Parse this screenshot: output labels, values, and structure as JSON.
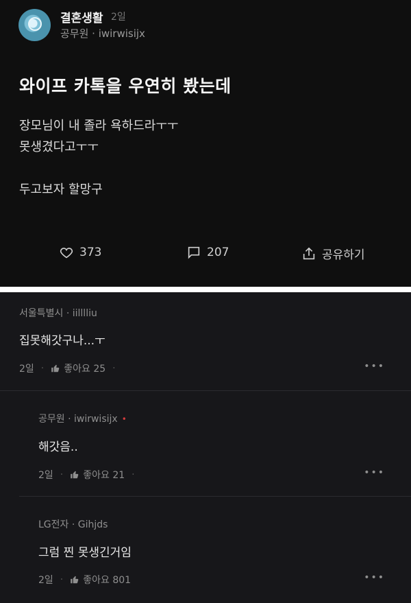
{
  "post": {
    "board": "결혼생활",
    "age": "2일",
    "author": "공무원 · iwirwisijx",
    "title": "와이프 카톡을 우연히 봤는데",
    "body": [
      "장모님이 내 졸라 욕하드라ㅜㅜ",
      "못생겼다고ㅜㅜ",
      "",
      "두고보자 할망구"
    ],
    "likes": "373",
    "comments": "207",
    "share_label": "공유하기"
  },
  "comments": [
    {
      "author": "서울특별시 · iilllliu",
      "text": "집못해갓구나...ㅜ",
      "age": "2일",
      "likes": "좋아요 25",
      "author_mark": ""
    },
    {
      "author": "공무원 · iwirwisijx",
      "text": "해갓음..",
      "age": "2일",
      "likes": "좋아요 21",
      "author_mark": "•"
    },
    {
      "author": "LG전자 · Gihjds",
      "text": "그럼 찐 못생긴거임",
      "age": "2일",
      "likes": "좋아요 801",
      "author_mark": ""
    }
  ],
  "icons": [
    "heart-icon",
    "comment-icon",
    "share-icon",
    "thumb-up-icon",
    "more-icon"
  ],
  "colors": {
    "background": "#0f0f0f",
    "comment_background": "#17171a",
    "author_mark": "#d43c3c"
  }
}
